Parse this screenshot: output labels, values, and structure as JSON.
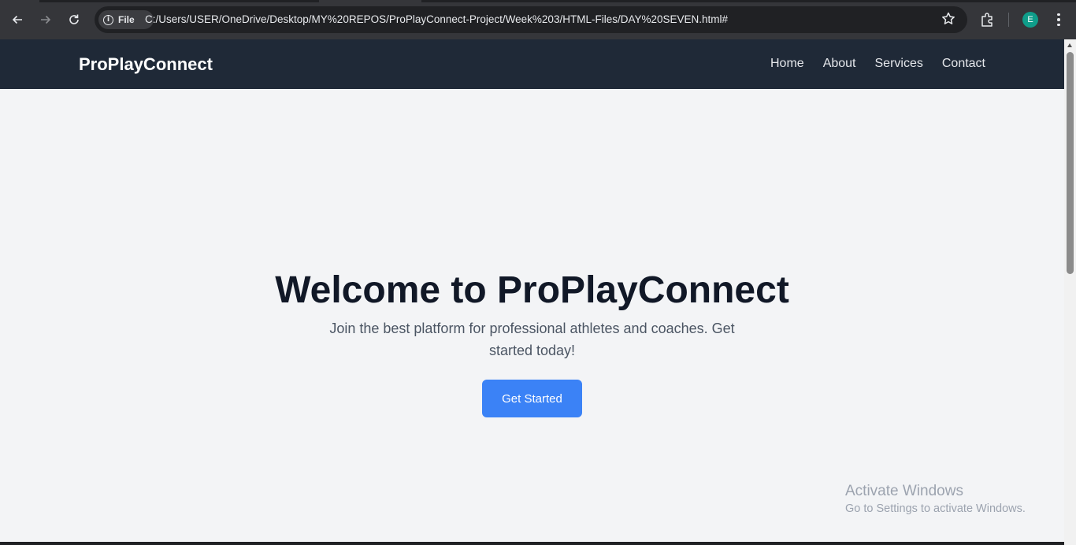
{
  "browser": {
    "site_chip_label": "File",
    "url": "C:/Users/USER/OneDrive/Desktop/MY%20REPOS/ProPlayConnect-Project/Week%203/HTML-Files/DAY%20SEVEN.html#",
    "profile_initial": "E",
    "profile_color": "#0f9d8a"
  },
  "navbar": {
    "brand": "ProPlayConnect",
    "links": [
      "Home",
      "About",
      "Services",
      "Contact"
    ],
    "background": "#1f2937"
  },
  "hero": {
    "title": "Welcome to ProPlayConnect",
    "subtitle": "Join the best platform for professional athletes and coaches. Get started today!",
    "cta_label": "Get Started",
    "cta_color": "#3b82f6"
  },
  "watermark": {
    "title": "Activate Windows",
    "subtitle": "Go to Settings to activate Windows."
  }
}
